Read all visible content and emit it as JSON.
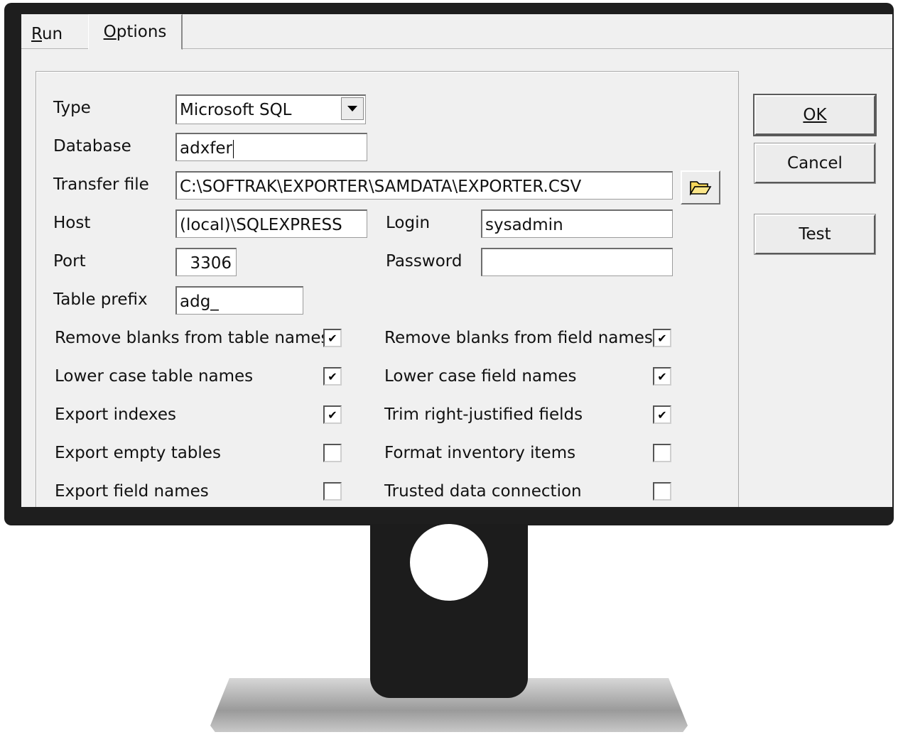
{
  "tabs": {
    "run": "Run",
    "options": "Options"
  },
  "form": {
    "type_label": "Type",
    "type_value": "Microsoft SQL",
    "database_label": "Database",
    "database_value": "adxfer",
    "transfer_label": "Transfer file",
    "transfer_value": "C:\\SOFTRAK\\EXPORTER\\SAMDATA\\EXPORTER.CSV",
    "host_label": "Host",
    "host_value": "(local)\\SQLEXPRESS",
    "login_label": "Login",
    "login_value": "sysadmin",
    "port_label": "Port",
    "port_value": "3306",
    "password_label": "Password",
    "password_value": "",
    "prefix_label": "Table prefix",
    "prefix_value": "adg_"
  },
  "options": [
    {
      "label": "Remove blanks from table names",
      "checked": true
    },
    {
      "label": "Remove blanks from field names",
      "checked": true
    },
    {
      "label": "Lower case table names",
      "checked": true
    },
    {
      "label": "Lower case field names",
      "checked": true
    },
    {
      "label": "Export indexes",
      "checked": true
    },
    {
      "label": "Trim right-justified fields",
      "checked": true
    },
    {
      "label": "Export empty tables",
      "checked": false
    },
    {
      "label": "Format inventory items",
      "checked": false
    },
    {
      "label": "Export field names",
      "checked": false
    },
    {
      "label": "Trusted data connection",
      "checked": false
    }
  ],
  "buttons": {
    "ok": "OK",
    "cancel": "Cancel",
    "test": "Test"
  },
  "icons": {
    "browse": "folder-open-icon",
    "dropdown": "chevron-down-icon",
    "check": "checkmark-icon"
  }
}
